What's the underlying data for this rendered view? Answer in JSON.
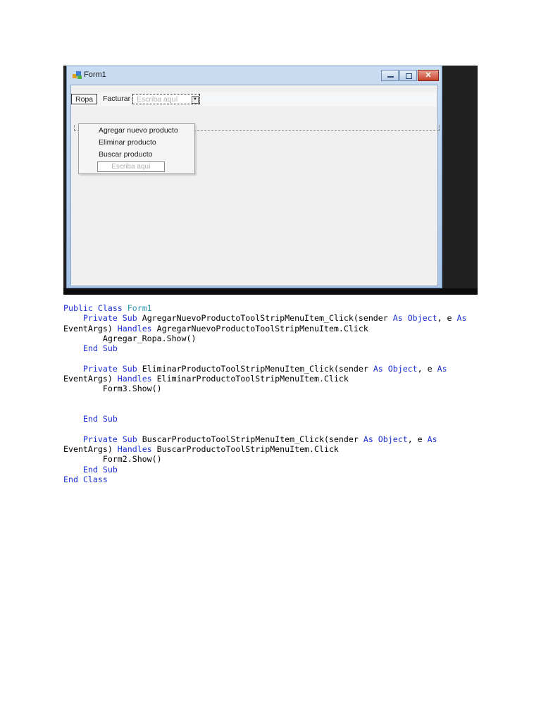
{
  "window": {
    "title": "Form1",
    "close_glyph": "✕"
  },
  "menu": {
    "items": [
      "Ropa",
      "Facturar"
    ],
    "type_here": "Escriba aquí"
  },
  "dropdown": {
    "items": [
      "Agregar nuevo producto",
      "Eliminar producto",
      "Buscar producto"
    ],
    "type_here": "Escriba aquí"
  },
  "code": {
    "keywords": {
      "public": "Public",
      "private": "Private",
      "sub": "Sub",
      "class": "Class",
      "as": "As",
      "object": "Object",
      "handles": "Handles",
      "end": "End"
    },
    "class_name": "Form1",
    "event_args": "EventArgs)",
    "sender": "(sender",
    "comma_e": ", e",
    "handlers": [
      {
        "name": "AgregarNuevoProductoToolStripMenuItem_Click",
        "handles": "AgregarNuevoProductoToolStripMenuItem.Click",
        "body": "Agregar_Ropa.Show()"
      },
      {
        "name": "EliminarProductoToolStripMenuItem_Click",
        "handles": "EliminarProductoToolStripMenuItem.Click",
        "body": "Form3.Show()"
      },
      {
        "name": "BuscarProductoToolStripMenuItem_Click",
        "handles": "BuscarProductoToolStripMenuItem.Click",
        "body": "Form2.Show()"
      }
    ]
  }
}
